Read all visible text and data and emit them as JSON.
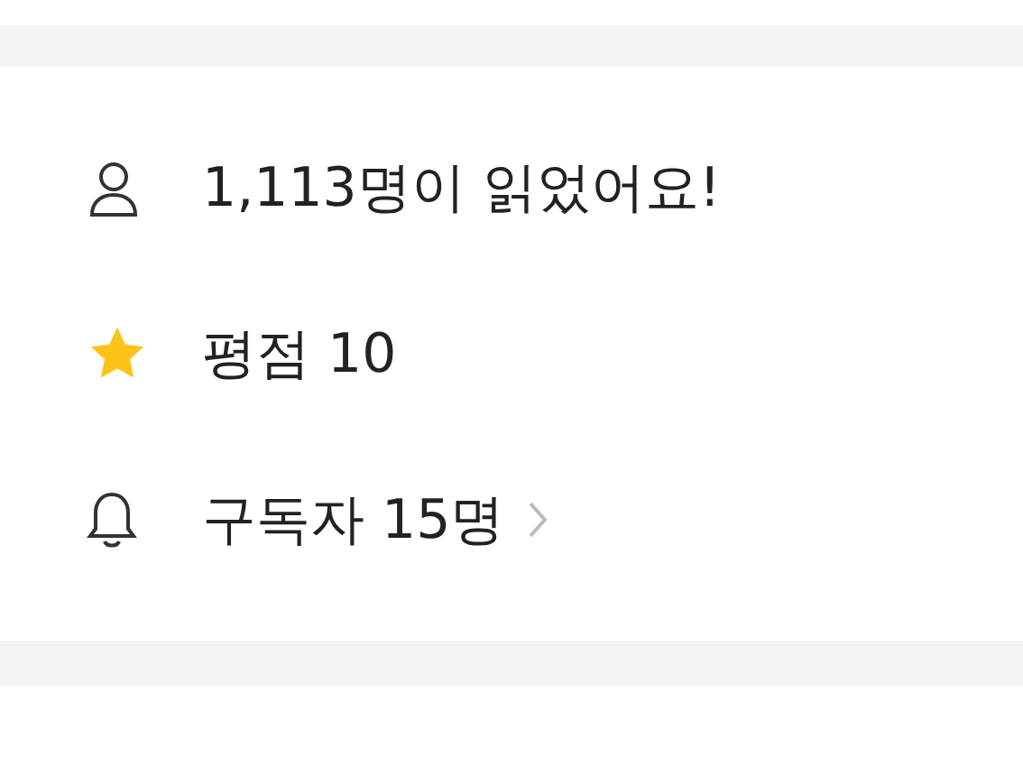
{
  "rows": [
    {
      "kind": "person",
      "text": "1,113명이 읽었어요!",
      "link": false
    },
    {
      "kind": "star",
      "text": "평점 10",
      "link": false
    },
    {
      "kind": "bell",
      "text": "구독자 15명",
      "link": true
    }
  ]
}
